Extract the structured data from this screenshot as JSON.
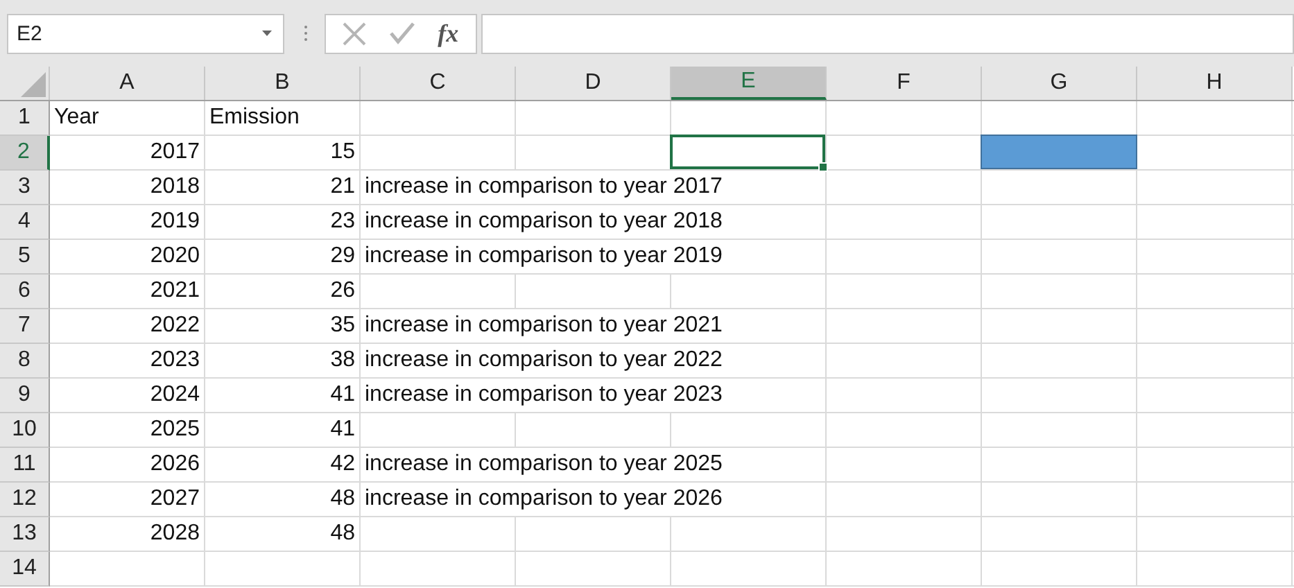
{
  "formula_bar": {
    "name_box": "E2",
    "function_label": "fx"
  },
  "columns": [
    {
      "label": "A",
      "selected": false
    },
    {
      "label": "B",
      "selected": false
    },
    {
      "label": "C",
      "selected": false
    },
    {
      "label": "D",
      "selected": false
    },
    {
      "label": "E",
      "selected": true
    },
    {
      "label": "F",
      "selected": false
    },
    {
      "label": "G",
      "selected": false
    },
    {
      "label": "H",
      "selected": false
    }
  ],
  "rows": [
    {
      "label": "1",
      "selected": false,
      "kind": "text",
      "year": "Year",
      "emission": "Emission"
    },
    {
      "label": "2",
      "selected": true,
      "kind": "number",
      "year": "2017",
      "emission": "15",
      "g_fill": {
        "color": "#5b9bd5"
      }
    },
    {
      "label": "3",
      "selected": false,
      "kind": "number",
      "year": "2018",
      "emission": "21",
      "note": "increase in comparison to year 2017"
    },
    {
      "label": "4",
      "selected": false,
      "kind": "number",
      "year": "2019",
      "emission": "23",
      "note": "increase in comparison to year 2018"
    },
    {
      "label": "5",
      "selected": false,
      "kind": "number",
      "year": "2020",
      "emission": "29",
      "note": "increase in comparison to year 2019"
    },
    {
      "label": "6",
      "selected": false,
      "kind": "number",
      "year": "2021",
      "emission": "26"
    },
    {
      "label": "7",
      "selected": false,
      "kind": "number",
      "year": "2022",
      "emission": "35",
      "note": "increase in comparison to year 2021"
    },
    {
      "label": "8",
      "selected": false,
      "kind": "number",
      "year": "2023",
      "emission": "38",
      "note": "increase in comparison to year 2022"
    },
    {
      "label": "9",
      "selected": false,
      "kind": "number",
      "year": "2024",
      "emission": "41",
      "note": "increase in comparison to year 2023"
    },
    {
      "label": "10",
      "selected": false,
      "kind": "number",
      "year": "2025",
      "emission": "41"
    },
    {
      "label": "11",
      "selected": false,
      "kind": "number",
      "year": "2026",
      "emission": "42",
      "note": "increase in comparison to year 2025"
    },
    {
      "label": "12",
      "selected": false,
      "kind": "number",
      "year": "2027",
      "emission": "48",
      "note": "increase in comparison to year 2026"
    },
    {
      "label": "13",
      "selected": false,
      "kind": "number",
      "year": "2028",
      "emission": "48"
    },
    {
      "label": "14",
      "selected": false
    }
  ]
}
